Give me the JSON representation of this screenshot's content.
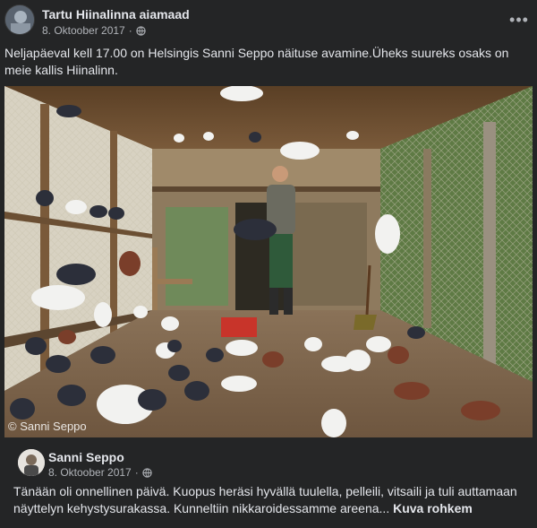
{
  "post": {
    "author": "Tartu Hiinalinna aiamaad",
    "date": "8. Oktoober 2017",
    "dot": "·",
    "more_icon": "more-horizontal-icon",
    "privacy_icon": "globe-icon",
    "text": "Neljapäeval kell 17.00 on Helsingis Sanni Seppo näituse avamine.Üheks suureks osaks on meie kallis Hiinalinn.",
    "photo": {
      "description_icon": "pigeon-loft-photo",
      "watermark": "© Sanni Seppo"
    }
  },
  "shared": {
    "author": "Sanni Seppo",
    "date": "8. Oktoober 2017",
    "dot": "·",
    "privacy_icon": "globe-icon",
    "text": "Tänään oli onnellinen päivä. Kuopus heräsi hyvällä tuulella, pelleili, vitsaili ja tuli auttamaan näyttelyn kehystysurakassa. Kunneltiin nikkaroidessamme areena...",
    "see_more": "Kuva rohkem"
  },
  "colors": {
    "background": "#242526",
    "text": "#e4e6eb",
    "secondary": "#b0b3b8"
  }
}
